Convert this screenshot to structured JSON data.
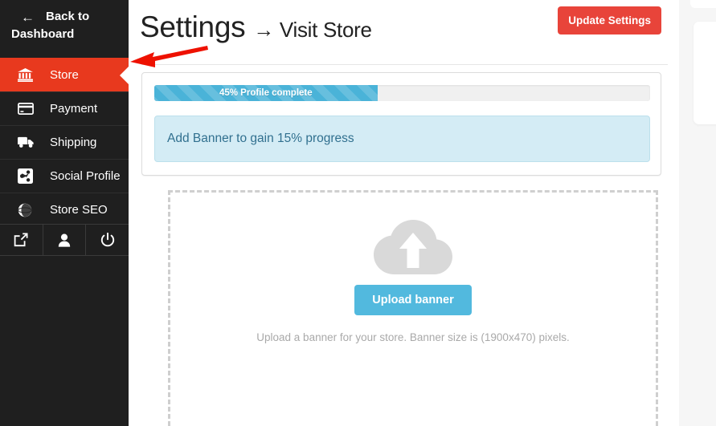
{
  "sidebar": {
    "back": {
      "label_line1": "Back to",
      "label_line2": "Dashboard",
      "icon": "arrow-left-icon",
      "arrow": "←"
    },
    "items": [
      {
        "label": "Store",
        "icon": "bank-icon",
        "active": true
      },
      {
        "label": "Payment",
        "icon": "credit-card-icon",
        "active": false
      },
      {
        "label": "Shipping",
        "icon": "truck-icon",
        "active": false
      },
      {
        "label": "Social Profile",
        "icon": "share-icon",
        "active": false
      },
      {
        "label": "Store SEO",
        "icon": "globe-icon",
        "active": false
      }
    ],
    "bottom_icons": [
      {
        "name": "external-link-icon",
        "title": "Visit Store"
      },
      {
        "name": "user-icon",
        "title": "Account"
      },
      {
        "name": "power-icon",
        "title": "Logout"
      }
    ],
    "colors": {
      "background": "#1f1f1f",
      "active": "#e8391e",
      "text": "#ffffff"
    }
  },
  "header": {
    "title_main": "Settings",
    "title_sub": "→ Visit Store",
    "update_button": "Update Settings",
    "button_color": "#e8443a"
  },
  "profile_card": {
    "progress": {
      "label": "45% Profile complete",
      "percent": 45,
      "bar_color": "#4ab3d8",
      "track_color": "#f0f0f0"
    },
    "alert": {
      "text": "Add Banner to gain 15% progress",
      "background": "#d4ecf5",
      "text_color": "#31708f"
    }
  },
  "dropzone": {
    "icon": "cloud-upload-icon",
    "button_label": "Upload banner",
    "button_color": "#52b9de",
    "hint": "Upload a banner for your store. Banner size is (1900x470) pixels.",
    "border_style": "dashed",
    "border_color": "#cfcfcf"
  },
  "annotation": {
    "type": "arrow",
    "color": "#ee1100",
    "points_to": "sidebar-item-store"
  }
}
